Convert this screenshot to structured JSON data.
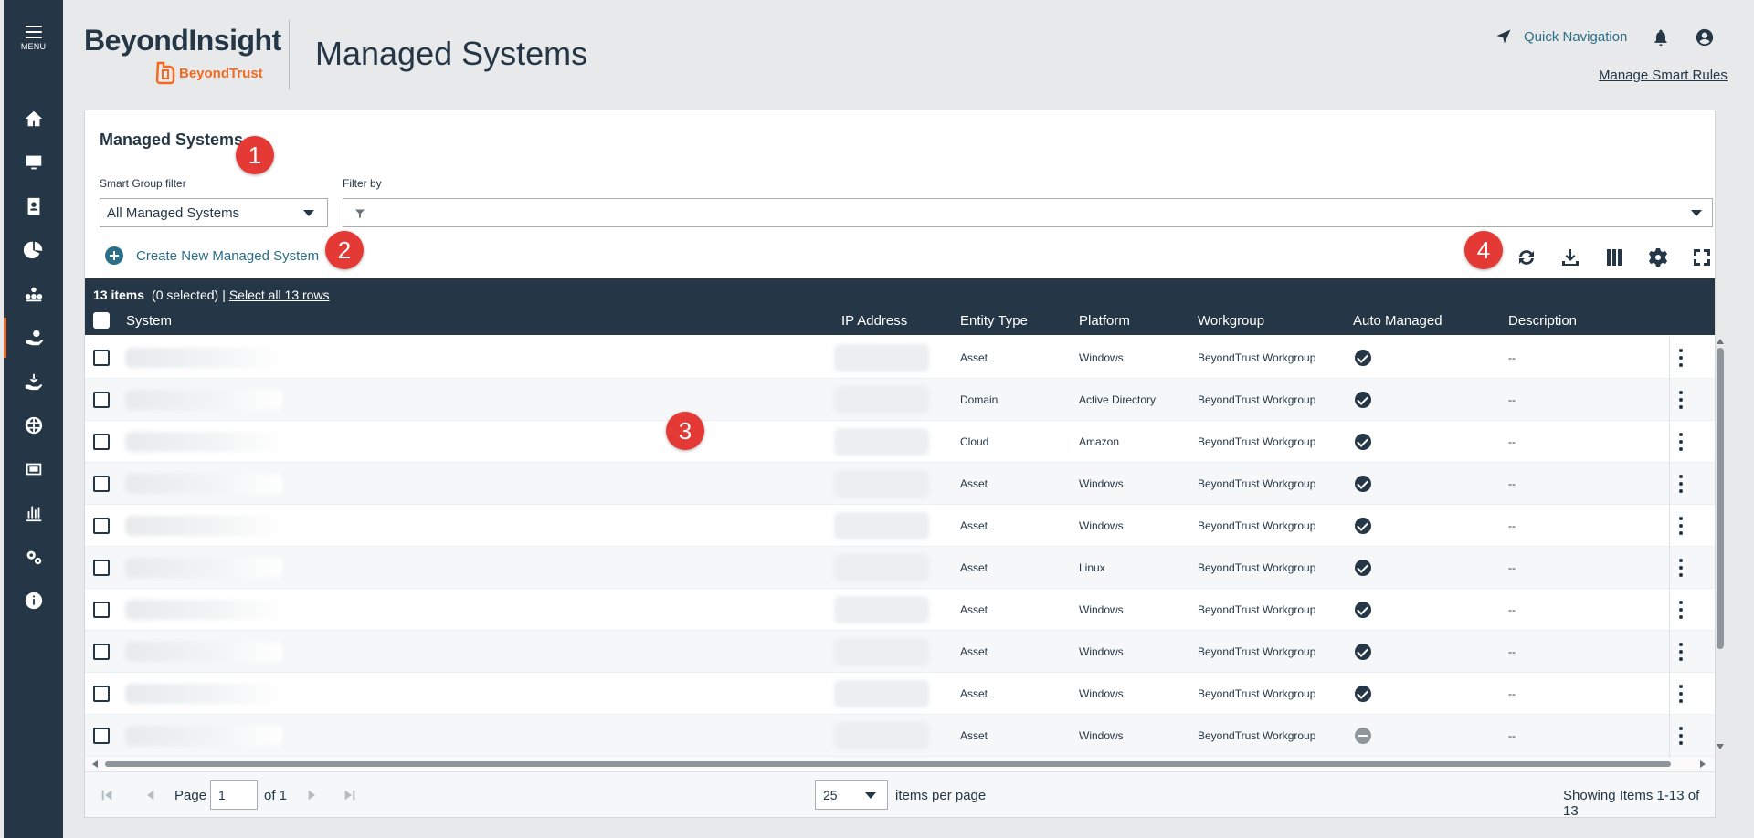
{
  "sidebar": {
    "menu_label": "MENU",
    "items": [
      {
        "icon": "home-icon"
      },
      {
        "icon": "monitor-icon"
      },
      {
        "icon": "asset-icon"
      },
      {
        "icon": "analytics-icon"
      },
      {
        "icon": "discovery-icon"
      },
      {
        "icon": "managed-systems-icon",
        "active": true
      },
      {
        "icon": "endpoint-icon"
      },
      {
        "icon": "globe-icon"
      },
      {
        "icon": "credentials-icon"
      },
      {
        "icon": "reports-icon"
      },
      {
        "icon": "configuration-icon"
      },
      {
        "icon": "info-icon"
      }
    ]
  },
  "header": {
    "brand_main": "BeyondInsight",
    "brand_sub": "BeyondTrust",
    "page_title": "Managed Systems",
    "quick_nav": "Quick Navigation",
    "manage_smart_rules": "Manage Smart Rules"
  },
  "panel": {
    "title": "Managed Systems",
    "smart_group_label": "Smart Group filter",
    "smart_group_value": "All Managed Systems",
    "filter_label": "Filter by",
    "create_label": "Create New Managed System"
  },
  "callouts": [
    "1",
    "2",
    "3",
    "4"
  ],
  "toolbar_icons": [
    "refresh-icon",
    "download-icon",
    "columns-icon",
    "settings-icon",
    "fullscreen-icon"
  ],
  "grid": {
    "count_label": "13 items",
    "selected_label": "(0 selected)",
    "separator": "|",
    "select_all": "Select all 13 rows",
    "columns": [
      "System",
      "IP Address",
      "Entity Type",
      "Platform",
      "Workgroup",
      "Auto Managed",
      "Description"
    ],
    "rows": [
      {
        "entity": "Asset",
        "platform": "Windows",
        "workgroup": "BeyondTrust Workgroup",
        "auto": "check",
        "description": "--"
      },
      {
        "entity": "Domain",
        "platform": "Active Directory",
        "workgroup": "BeyondTrust Workgroup",
        "auto": "check",
        "description": "--"
      },
      {
        "entity": "Cloud",
        "platform": "Amazon",
        "workgroup": "BeyondTrust Workgroup",
        "auto": "check",
        "description": "--"
      },
      {
        "entity": "Asset",
        "platform": "Windows",
        "workgroup": "BeyondTrust Workgroup",
        "auto": "check",
        "description": "--"
      },
      {
        "entity": "Asset",
        "platform": "Windows",
        "workgroup": "BeyondTrust Workgroup",
        "auto": "check",
        "description": "--"
      },
      {
        "entity": "Asset",
        "platform": "Linux",
        "workgroup": "BeyondTrust Workgroup",
        "auto": "check",
        "description": "--"
      },
      {
        "entity": "Asset",
        "platform": "Windows",
        "workgroup": "BeyondTrust Workgroup",
        "auto": "check",
        "description": "--"
      },
      {
        "entity": "Asset",
        "platform": "Windows",
        "workgroup": "BeyondTrust Workgroup",
        "auto": "check",
        "description": "--"
      },
      {
        "entity": "Asset",
        "platform": "Windows",
        "workgroup": "BeyondTrust Workgroup",
        "auto": "check",
        "description": "--"
      },
      {
        "entity": "Asset",
        "platform": "Windows",
        "workgroup": "BeyondTrust Workgroup",
        "auto": "minus",
        "description": "--"
      }
    ]
  },
  "pager": {
    "page_label": "Page",
    "page_value": "1",
    "of_label": "of 1",
    "per_page_value": "25",
    "per_page_label": "items per page",
    "showing": "Showing Items 1-13 of 13"
  }
}
